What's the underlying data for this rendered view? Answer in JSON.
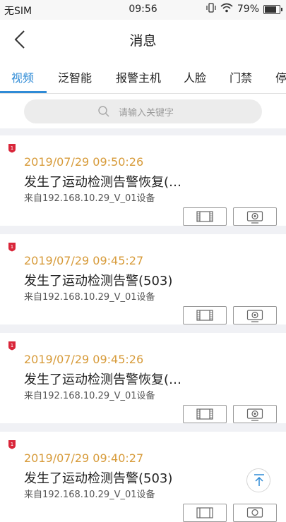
{
  "status_bar": {
    "carrier": "无SIM",
    "time": "09:56",
    "battery": "79%"
  },
  "header": {
    "title": "消息"
  },
  "tabs": [
    {
      "label": "视频"
    },
    {
      "label": "泛智能"
    },
    {
      "label": "报警主机"
    },
    {
      "label": "人脸"
    },
    {
      "label": "门禁"
    },
    {
      "label": "停"
    }
  ],
  "search": {
    "placeholder": "请输入关键字"
  },
  "messages": [
    {
      "badge": "1",
      "time": "2019/07/29 09:50:26",
      "title": "发生了运动检测告警恢复(…",
      "source": "来自192.168.10.29_V_01设备"
    },
    {
      "badge": "1",
      "time": "2019/07/29 09:45:27",
      "title": "发生了运动检测告警(503)",
      "source": "来自192.168.10.29_V_01设备"
    },
    {
      "badge": "1",
      "time": "2019/07/29 09:45:26",
      "title": "发生了运动检测告警恢复(…",
      "source": "来自192.168.10.29_V_01设备"
    },
    {
      "badge": "1",
      "time": "2019/07/29 09:40:27",
      "title": "发生了运动检测告警(503)",
      "source": "来自192.168.10.29_V_01设备"
    }
  ],
  "colors": {
    "accent": "#2f8bd6",
    "timestamp": "#d79b3a",
    "badge": "#d9263a"
  },
  "icons": [
    "chevron-left-icon",
    "search-icon",
    "film-icon",
    "monitor-icon",
    "arrow-up-icon",
    "alert-badge-icon",
    "wifi-icon",
    "battery-icon"
  ]
}
